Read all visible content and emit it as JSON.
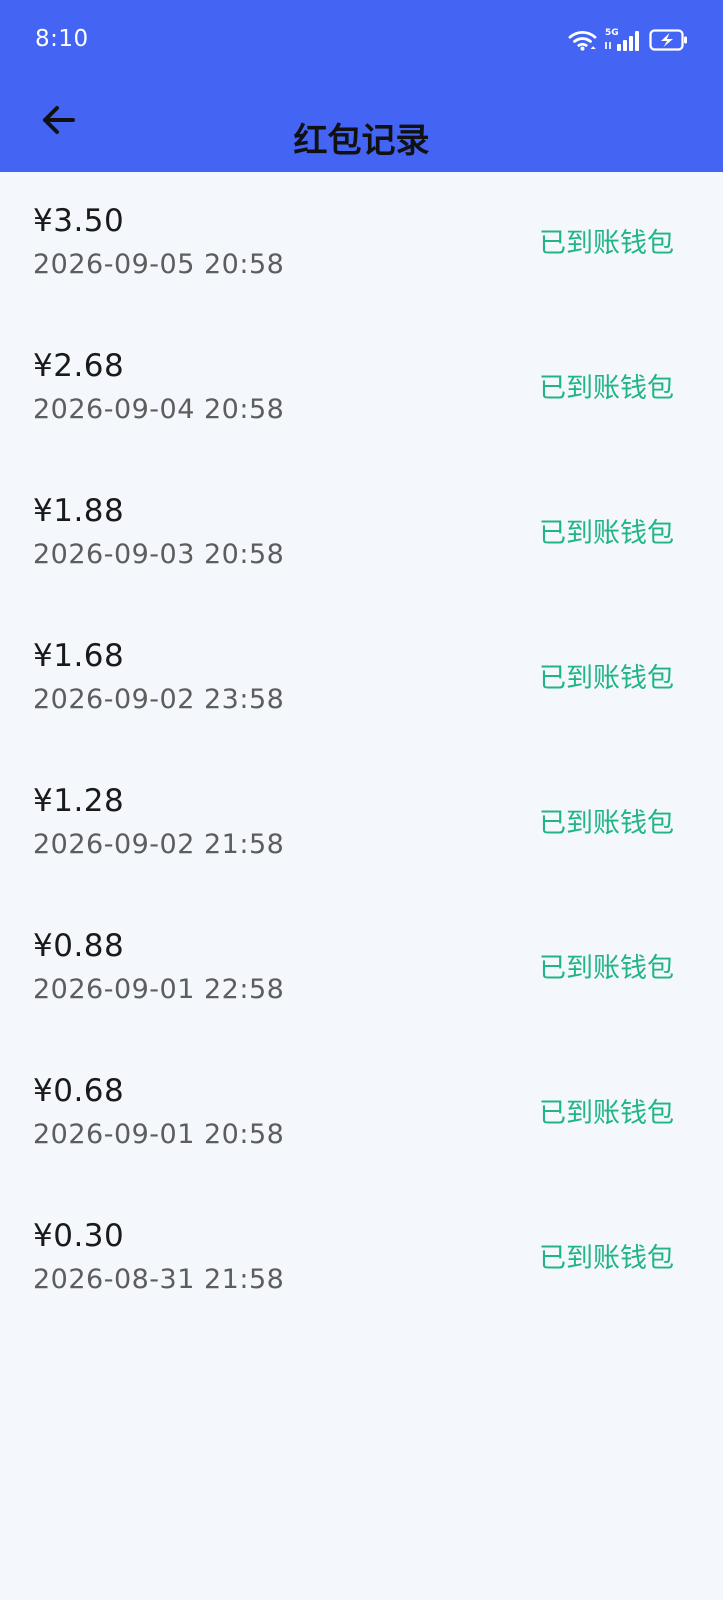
{
  "status_bar": {
    "time": "8:10",
    "network_label": "5G",
    "icons": [
      "wifi-icon",
      "signal-icon",
      "battery-charging-icon"
    ]
  },
  "header": {
    "title": "红包记录",
    "back_icon": "arrow-left-icon"
  },
  "colors": {
    "header_background": "#4464F4",
    "page_background": "#F4F7FC",
    "amount_text": "#1A1A1A",
    "time_text": "#5D5D5D",
    "status_text": "#20B486"
  },
  "records": [
    {
      "amount": "¥3.50",
      "time": "2026-09-05 20:58",
      "status": "已到账钱包"
    },
    {
      "amount": "¥2.68",
      "time": "2026-09-04 20:58",
      "status": "已到账钱包"
    },
    {
      "amount": "¥1.88",
      "time": "2026-09-03 20:58",
      "status": "已到账钱包"
    },
    {
      "amount": "¥1.68",
      "time": "2026-09-02 23:58",
      "status": "已到账钱包"
    },
    {
      "amount": "¥1.28",
      "time": "2026-09-02 21:58",
      "status": "已到账钱包"
    },
    {
      "amount": "¥0.88",
      "time": "2026-09-01 22:58",
      "status": "已到账钱包"
    },
    {
      "amount": "¥0.68",
      "time": "2026-09-01 20:58",
      "status": "已到账钱包"
    },
    {
      "amount": "¥0.30",
      "time": "2026-08-31 21:58",
      "status": "已到账钱包"
    }
  ]
}
